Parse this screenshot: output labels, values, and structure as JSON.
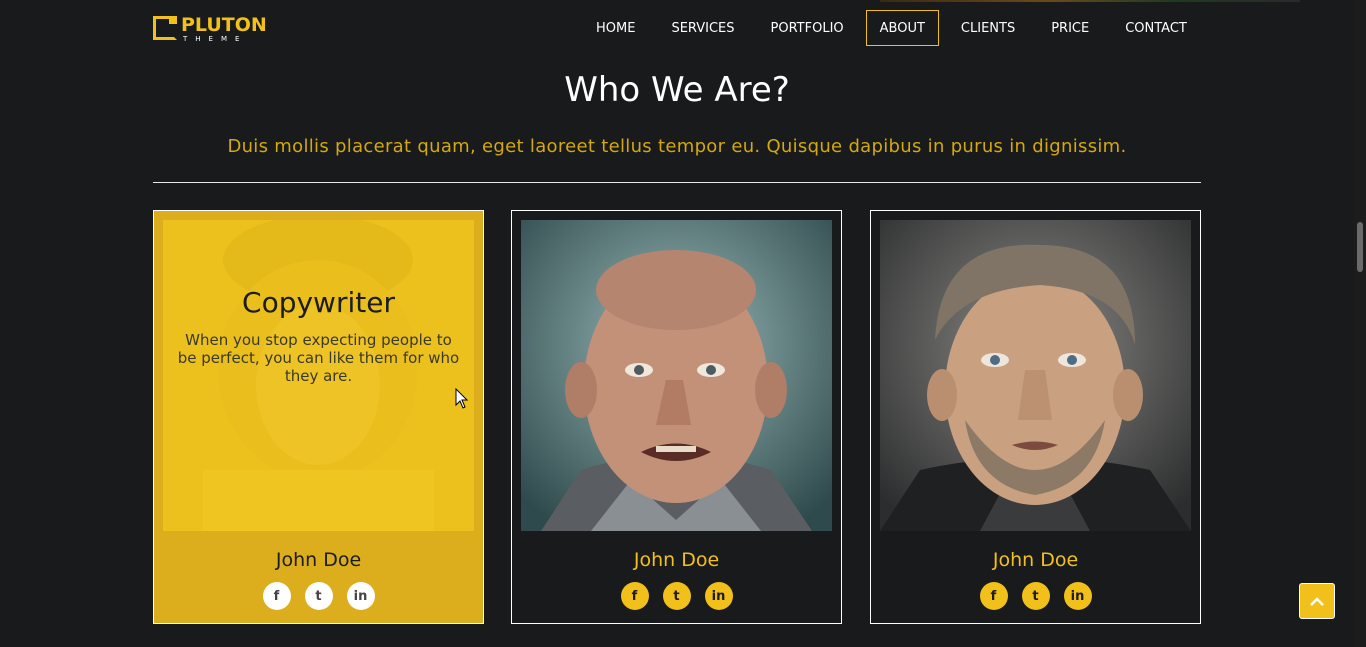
{
  "brand": {
    "name": "PLUTON",
    "sub": "THEME",
    "accent_color": "#f2c01b"
  },
  "nav": {
    "items": [
      {
        "label": "HOME"
      },
      {
        "label": "SERVICES"
      },
      {
        "label": "PORTFOLIO"
      },
      {
        "label": "ABOUT",
        "active": true
      },
      {
        "label": "CLIENTS"
      },
      {
        "label": "PRICE"
      },
      {
        "label": "CONTACT"
      }
    ]
  },
  "section": {
    "title": "Who We Are?",
    "subtitle": "Duis mollis placerat quam, eget laoreet tellus tempor eu. Quisque dapibus in purus in dignissim."
  },
  "team": [
    {
      "name": "John Doe",
      "role": "Copywriter",
      "quote": "When you stop expecting people to be perfect, you can like them for who they are.",
      "hovered": true,
      "socials": [
        "f",
        "t",
        "in"
      ]
    },
    {
      "name": "John Doe",
      "socials": [
        "f",
        "t",
        "in"
      ]
    },
    {
      "name": "John Doe",
      "socials": [
        "f",
        "t",
        "in"
      ]
    }
  ],
  "icons": {
    "social": [
      "facebook-icon",
      "twitter-icon",
      "linkedin-icon"
    ],
    "back_to_top": "chevron-up-icon"
  }
}
